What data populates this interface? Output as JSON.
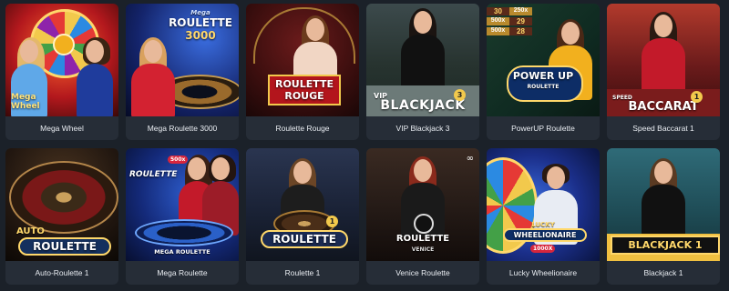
{
  "games": [
    {
      "title": "Mega Wheel",
      "art_logo": "Mega Wheel"
    },
    {
      "title": "Mega Roulette 3000",
      "art_logo": "ROULETTE",
      "art_logo_top": "Mega",
      "art_logo_sub": "3000"
    },
    {
      "title": "Roulette Rouge",
      "art_logo": "ROULETTE ROUGE"
    },
    {
      "title": "VIP Blackjack 3",
      "art_logo": "BLACKJACK",
      "art_logo_top": "VIP",
      "badge": "3"
    },
    {
      "title": "PowerUP Roulette",
      "art_logo": "POWER UP",
      "art_logo_sub": "ROULETTE",
      "board_values": [
        "30",
        "250x",
        "500x",
        "29",
        "500x",
        "28"
      ]
    },
    {
      "title": "Speed Baccarat 1",
      "art_logo": "BACCARAT",
      "art_logo_top": "SPEED",
      "badge": "1"
    },
    {
      "title": "Auto-Roulette 1",
      "art_logo": "ROULETTE",
      "art_logo_top": "AUTO"
    },
    {
      "title": "Mega Roulette",
      "art_logo": "MEGA ROULETTE",
      "art_logo_top": "ROULETTE",
      "multiplier": "500x"
    },
    {
      "title": "Roulette 1",
      "art_logo": "ROULETTE",
      "badge": "1"
    },
    {
      "title": "Venice Roulette",
      "art_logo": "ROULETTE",
      "art_logo_sub": "VENICE"
    },
    {
      "title": "Lucky Wheelionaire",
      "art_logo": "WHEELIONAIRE",
      "art_logo_top": "LUCKY",
      "art_logo_sub": "1000X"
    },
    {
      "title": "Blackjack 1",
      "art_logo": "BLACKJACK 1"
    }
  ],
  "colors": {
    "page_background": "#1b2129",
    "tile_background": "#262d37",
    "caption_text": "#e9edf2",
    "accent_gold": "#f2c94c"
  }
}
